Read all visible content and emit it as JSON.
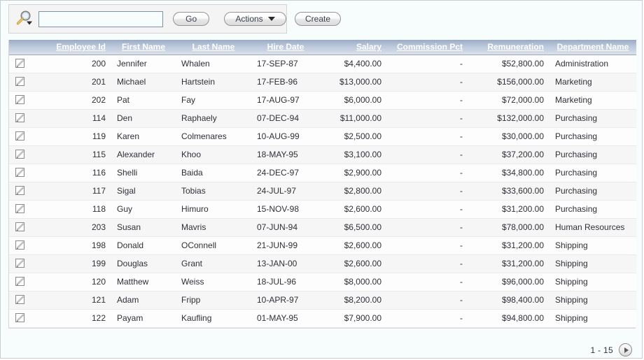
{
  "toolbar": {
    "search_icon": "magnifier-dropdown-icon",
    "search_value": "",
    "search_placeholder": "",
    "go_label": "Go",
    "actions_label": "Actions",
    "create_label": "Create"
  },
  "report": {
    "columns": [
      {
        "key": "edit",
        "label": "",
        "class": "c-edit"
      },
      {
        "key": "empid",
        "label": "Employee Id",
        "class": "c-empid"
      },
      {
        "key": "first",
        "label": "First Name",
        "class": "c-first"
      },
      {
        "key": "last",
        "label": "Last Name",
        "class": "c-last"
      },
      {
        "key": "hire",
        "label": "Hire Date",
        "class": "c-hire"
      },
      {
        "key": "sal",
        "label": "Salary",
        "class": "c-sal"
      },
      {
        "key": "comm",
        "label": "Commission Pct",
        "class": "c-comm"
      },
      {
        "key": "remun",
        "label": "Remuneration",
        "class": "c-remun"
      },
      {
        "key": "dept",
        "label": "Department Name",
        "class": "c-dept"
      }
    ],
    "rows": [
      {
        "empid": "200",
        "first": "Jennifer",
        "last": "Whalen",
        "hire": "17-SEP-87",
        "sal": "$4,400.00",
        "comm": "-",
        "remun": "$52,800.00",
        "dept": "Administration"
      },
      {
        "empid": "201",
        "first": "Michael",
        "last": "Hartstein",
        "hire": "17-FEB-96",
        "sal": "$13,000.00",
        "comm": "-",
        "remun": "$156,000.00",
        "dept": "Marketing"
      },
      {
        "empid": "202",
        "first": "Pat",
        "last": "Fay",
        "hire": "17-AUG-97",
        "sal": "$6,000.00",
        "comm": "-",
        "remun": "$72,000.00",
        "dept": "Marketing"
      },
      {
        "empid": "114",
        "first": "Den",
        "last": "Raphaely",
        "hire": "07-DEC-94",
        "sal": "$11,000.00",
        "comm": "-",
        "remun": "$132,000.00",
        "dept": "Purchasing"
      },
      {
        "empid": "119",
        "first": "Karen",
        "last": "Colmenares",
        "hire": "10-AUG-99",
        "sal": "$2,500.00",
        "comm": "-",
        "remun": "$30,000.00",
        "dept": "Purchasing"
      },
      {
        "empid": "115",
        "first": "Alexander",
        "last": "Khoo",
        "hire": "18-MAY-95",
        "sal": "$3,100.00",
        "comm": "-",
        "remun": "$37,200.00",
        "dept": "Purchasing"
      },
      {
        "empid": "116",
        "first": "Shelli",
        "last": "Baida",
        "hire": "24-DEC-97",
        "sal": "$2,900.00",
        "comm": "-",
        "remun": "$34,800.00",
        "dept": "Purchasing"
      },
      {
        "empid": "117",
        "first": "Sigal",
        "last": "Tobias",
        "hire": "24-JUL-97",
        "sal": "$2,800.00",
        "comm": "-",
        "remun": "$33,600.00",
        "dept": "Purchasing"
      },
      {
        "empid": "118",
        "first": "Guy",
        "last": "Himuro",
        "hire": "15-NOV-98",
        "sal": "$2,600.00",
        "comm": "-",
        "remun": "$31,200.00",
        "dept": "Purchasing"
      },
      {
        "empid": "203",
        "first": "Susan",
        "last": "Mavris",
        "hire": "07-JUN-94",
        "sal": "$6,500.00",
        "comm": "-",
        "remun": "$78,000.00",
        "dept": "Human Resources"
      },
      {
        "empid": "198",
        "first": "Donald",
        "last": "OConnell",
        "hire": "21-JUN-99",
        "sal": "$2,600.00",
        "comm": "-",
        "remun": "$31,200.00",
        "dept": "Shipping"
      },
      {
        "empid": "199",
        "first": "Douglas",
        "last": "Grant",
        "hire": "13-JAN-00",
        "sal": "$2,600.00",
        "comm": "-",
        "remun": "$31,200.00",
        "dept": "Shipping"
      },
      {
        "empid": "120",
        "first": "Matthew",
        "last": "Weiss",
        "hire": "18-JUL-96",
        "sal": "$8,000.00",
        "comm": "-",
        "remun": "$96,000.00",
        "dept": "Shipping"
      },
      {
        "empid": "121",
        "first": "Adam",
        "last": "Fripp",
        "hire": "10-APR-97",
        "sal": "$8,200.00",
        "comm": "-",
        "remun": "$98,400.00",
        "dept": "Shipping"
      },
      {
        "empid": "122",
        "first": "Payam",
        "last": "Kaufling",
        "hire": "01-MAY-95",
        "sal": "$7,900.00",
        "comm": "-",
        "remun": "$94,800.00",
        "dept": "Shipping"
      }
    ],
    "row_edit_icon": "edit-pencil-icon"
  },
  "pagination": {
    "range_label": "1 - 15",
    "next_icon": "chevron-right-icon"
  },
  "colors": {
    "header_gradient_top": "#97a9c4",
    "header_gradient_bottom": "#dde3ec",
    "header_text": "#ffffff",
    "page_background": "#f7fdfd",
    "toolbar_background": "#f4f4f4",
    "row_odd": "#fdfdfd",
    "row_even": "#f6f6f6",
    "cell_text": "#2f2f38"
  }
}
